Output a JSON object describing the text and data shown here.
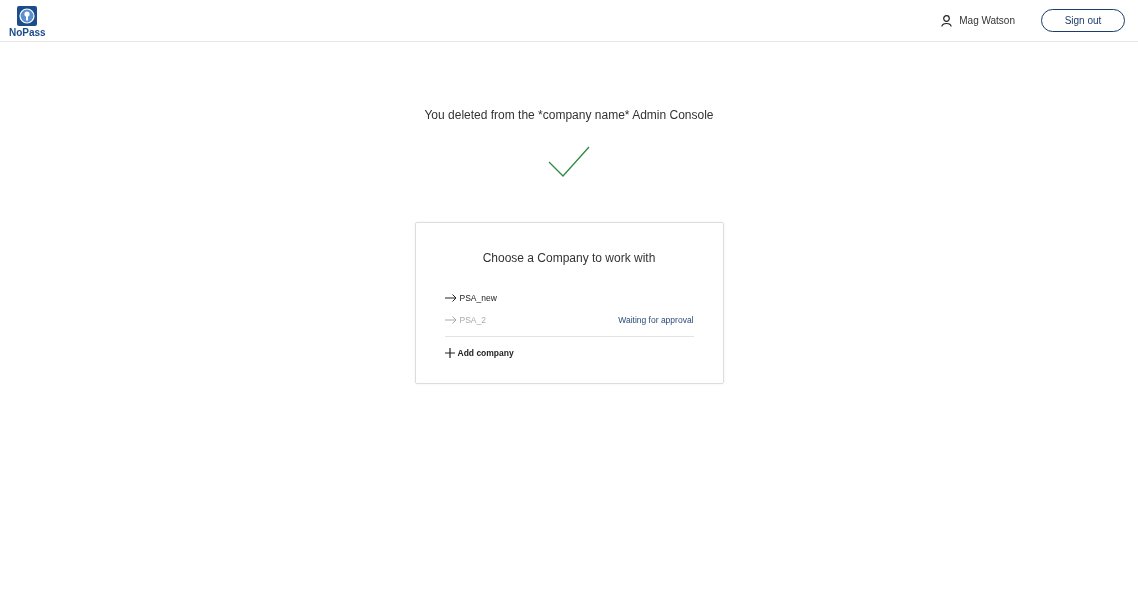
{
  "header": {
    "logo_text": "NoPass",
    "user_name": "Mag Watson",
    "sign_out": "Sign out"
  },
  "message": "You deleted from the *company name* Admin Console",
  "card": {
    "title": "Choose a Company to work with",
    "companies": [
      {
        "name": "PSA_new",
        "disabled": false
      },
      {
        "name": "PSA_2",
        "disabled": true,
        "status": "Waiting for approval"
      }
    ],
    "add_label": "Add company"
  }
}
